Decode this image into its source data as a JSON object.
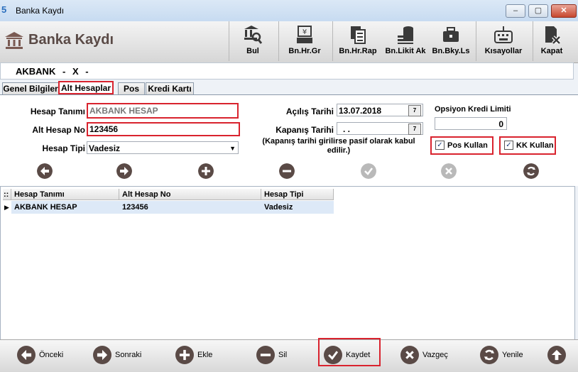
{
  "window": {
    "title": "Banka Kaydı",
    "app_icon": "5",
    "controls": [
      "–",
      "▢",
      "✕"
    ]
  },
  "header": {
    "title": "Banka Kaydı",
    "toolbar": [
      {
        "label": "Bul",
        "icon": "search-bank-icon"
      },
      {
        "label": "Bn.Hr.Gr",
        "icon": "money-register-icon"
      },
      {
        "label": "Bn.Hr.Rap",
        "icon": "report-icon"
      },
      {
        "label": "Bn.Likit Ak",
        "icon": "coins-icon"
      },
      {
        "label": "Bn.Bky.Ls",
        "icon": "briefcase-icon"
      },
      {
        "label": "Kısayollar",
        "icon": "keyboard-icon"
      },
      {
        "label": "Kapat",
        "icon": "close-doc-icon"
      }
    ]
  },
  "record": {
    "name": "AKBANK",
    "sep1": "-",
    "code": "X",
    "sep2": "-"
  },
  "tabs": [
    "Genel Bilgiler",
    "Alt Hesaplar",
    "Pos",
    "Kredi Kartı"
  ],
  "form": {
    "hesap_tanimi_label": "Hesap Tanımı",
    "hesap_tanimi_value": "AKBANK HESAP",
    "alt_hesap_no_label": "Alt Hesap No",
    "alt_hesap_no_value": "123456",
    "hesap_tipi_label": "Hesap Tipi",
    "hesap_tipi_value": "Vadesiz",
    "acilis_tarihi_label": "Açılış Tarihi",
    "acilis_tarihi_value": "13.07.2018",
    "kapanis_tarihi_label": "Kapanış Tarihi",
    "kapanis_tarihi_value": ". .",
    "kapanis_note": "(Kapanış tarihi girilirse pasif olarak kabul edilir.)",
    "opsiyon_label": "Opsiyon Kredi Limiti",
    "opsiyon_value": "0",
    "pos_kullan_label": "Pos Kullan",
    "kk_kullan_label": "KK Kullan",
    "pos_kullan_checked": true,
    "kk_kullan_checked": true
  },
  "grid": {
    "columns": [
      "Hesap Tanımı",
      "Alt Hesap No",
      "Hesap Tipi"
    ],
    "rows": [
      [
        "AKBANK HESAP",
        "123456",
        "Vadesiz"
      ]
    ]
  },
  "footer": {
    "buttons": [
      {
        "label": "Önceki",
        "icon": "arrow-left-icon"
      },
      {
        "label": "Sonraki",
        "icon": "arrow-right-icon"
      },
      {
        "label": "Ekle",
        "icon": "plus-icon"
      },
      {
        "label": "Sil",
        "icon": "minus-icon"
      },
      {
        "label": "Kaydet",
        "icon": "check-icon"
      },
      {
        "label": "Vazgeç",
        "icon": "x-icon"
      },
      {
        "label": "Yenile",
        "icon": "refresh-icon"
      },
      {
        "label": "",
        "icon": "arrow-up-icon"
      }
    ]
  },
  "colors": {
    "accent_red": "#d9232e",
    "button_dark": "#5a4a46",
    "button_disabled": "#b9b9b9",
    "row_selected": "#dde9f7"
  }
}
